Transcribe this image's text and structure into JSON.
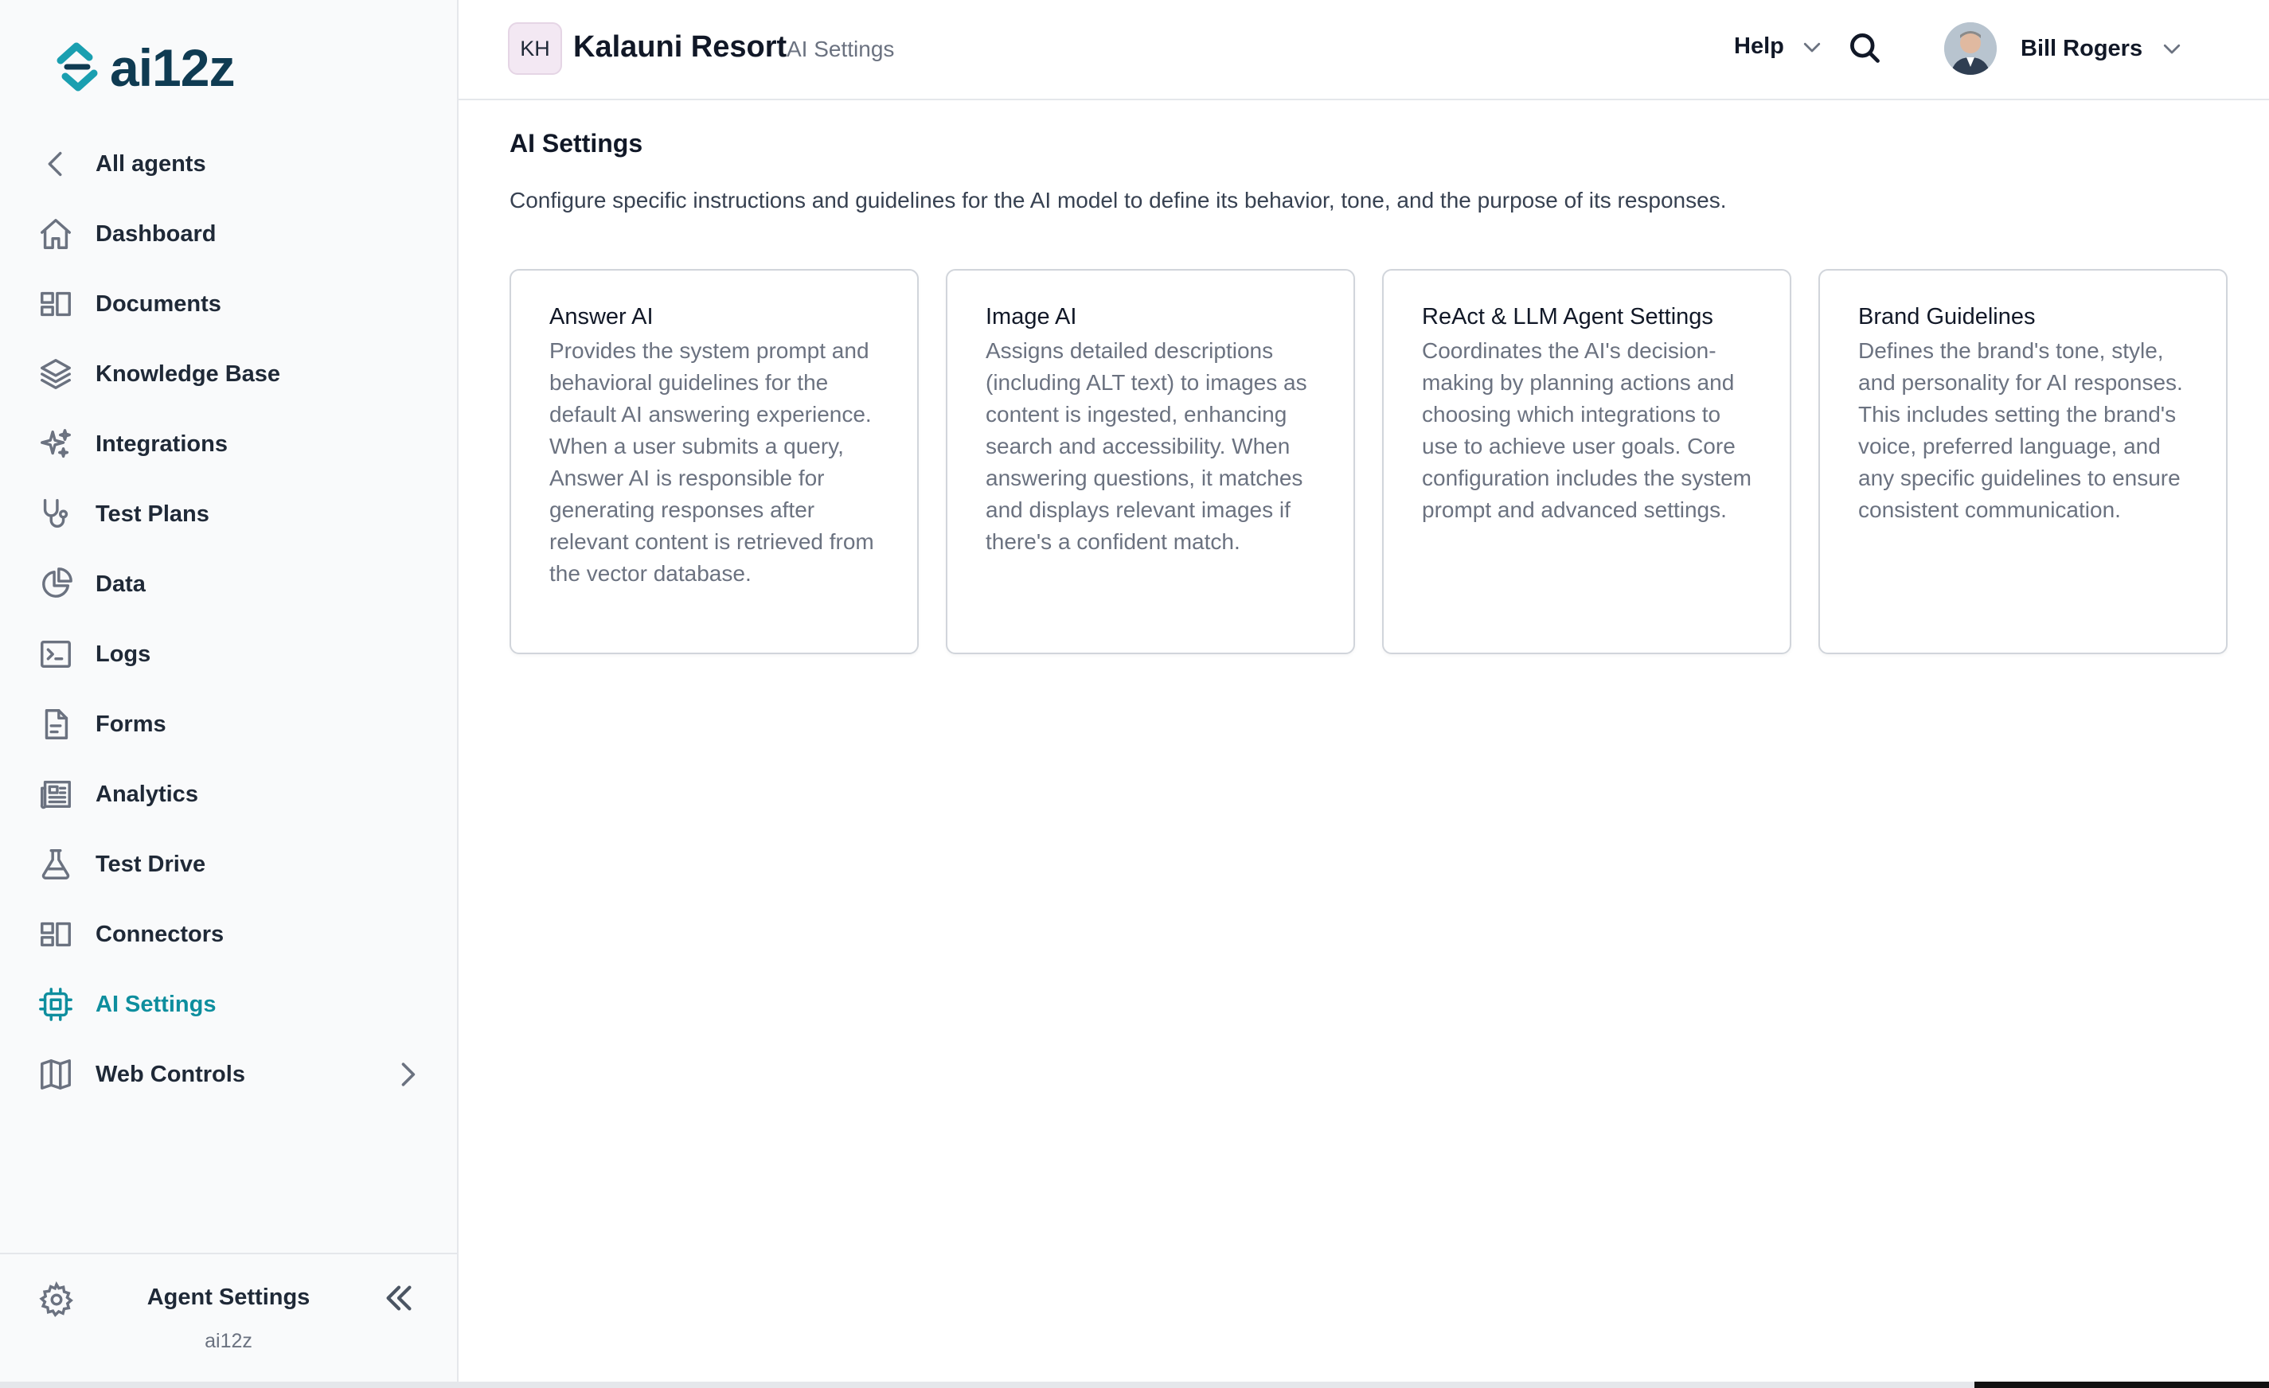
{
  "brand": {
    "logo_text": "ai12z"
  },
  "sidebar": {
    "items": [
      {
        "label": "All agents",
        "icon": "chevron-left-icon"
      },
      {
        "label": "Dashboard",
        "icon": "home-icon"
      },
      {
        "label": "Documents",
        "icon": "documents-icon"
      },
      {
        "label": "Knowledge Base",
        "icon": "layers-icon"
      },
      {
        "label": "Integrations",
        "icon": "sparkles-icon"
      },
      {
        "label": "Test Plans",
        "icon": "stethoscope-icon"
      },
      {
        "label": "Data",
        "icon": "pie-chart-icon"
      },
      {
        "label": "Logs",
        "icon": "terminal-icon"
      },
      {
        "label": "Forms",
        "icon": "file-icon"
      },
      {
        "label": "Analytics",
        "icon": "newspaper-icon"
      },
      {
        "label": "Test Drive",
        "icon": "flask-icon"
      },
      {
        "label": "Connectors",
        "icon": "connectors-icon"
      },
      {
        "label": "AI Settings",
        "icon": "chip-icon",
        "active": true
      },
      {
        "label": "Web Controls",
        "icon": "book-icon",
        "has_submenu": true
      }
    ],
    "footer": {
      "title": "Agent Settings",
      "subtitle": "ai12z"
    }
  },
  "header": {
    "org_initials": "KH",
    "org_name": "Kalauni Resort",
    "breadcrumb": "AI Settings",
    "help_label": "Help",
    "user_name": "Bill Rogers"
  },
  "main": {
    "title": "AI Settings",
    "description": "Configure specific instructions and guidelines for the AI model to define its behavior, tone, and the purpose of its responses.",
    "cards": [
      {
        "title": "Answer AI",
        "description": "Provides the system prompt and behavioral guidelines for the default AI answering experience. When a user submits a query, Answer AI is responsible for generating responses after relevant content is retrieved from the vector database."
      },
      {
        "title": "Image AI",
        "description": "Assigns detailed descriptions (including ALT text) to images as content is ingested, enhancing search and accessibility. When answering questions, it matches and displays relevant images if there's a confident match."
      },
      {
        "title": "ReAct & LLM Agent Settings",
        "description": "Coordinates the AI's decision-making by planning actions and choosing which integrations to use to achieve user goals. Core configuration includes the system prompt and advanced settings."
      },
      {
        "title": "Brand Guidelines",
        "description": "Defines the brand's tone, style, and personality for AI responses. This includes setting the brand's voice, preferred language, and any specific guidelines to ensure consistent communication."
      }
    ]
  },
  "colors": {
    "accent": "#0e8e9e",
    "logo": "#0f3b52",
    "border": "#e5e7eb"
  }
}
